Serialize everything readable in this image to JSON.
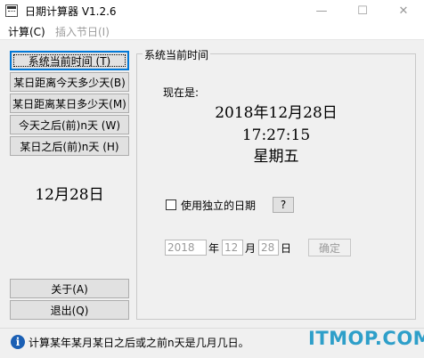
{
  "window": {
    "title": "日期计算器  V1.2.6",
    "controls": {
      "minimize": "—",
      "maximize": "☐",
      "close": "✕"
    }
  },
  "menu": [
    {
      "label": "计算(C)",
      "enabled": true
    },
    {
      "label": "插入节日(I)",
      "enabled": false
    }
  ],
  "left_buttons": [
    {
      "label": "系统当前时间    (T)",
      "focused": true
    },
    {
      "label": "某日距离今天多少天(B)",
      "focused": false
    },
    {
      "label": "某日距离某日多少天(M)",
      "focused": false
    },
    {
      "label": "今天之后(前)n天  (W)",
      "focused": false
    },
    {
      "label": "某日之后(前)n天  (H)",
      "focused": false
    }
  ],
  "left_date": "12月28日",
  "bottom_buttons": {
    "about": "关于(A)",
    "exit": "退出(Q)"
  },
  "group": {
    "title": "系统当前时间",
    "now_label": "现在是:",
    "date": "2018年12月28日",
    "time": "17:27:15",
    "weekday": "星期五"
  },
  "independent": {
    "label": "使用独立的日期",
    "checked": false,
    "help": "?"
  },
  "date_inputs": {
    "year": "2018",
    "year_unit": "年",
    "month": "12",
    "month_unit": "月",
    "day": "28",
    "day_unit": "日",
    "confirm": "确定"
  },
  "status": {
    "text": "计算某年某月某日之后或之前n天是几月几日。"
  },
  "watermark": "ITMOP.COM",
  "colors": {
    "focus_border": "#0078d7",
    "watermark": "#2e9fc9",
    "info_icon": "#1a5fb4"
  }
}
